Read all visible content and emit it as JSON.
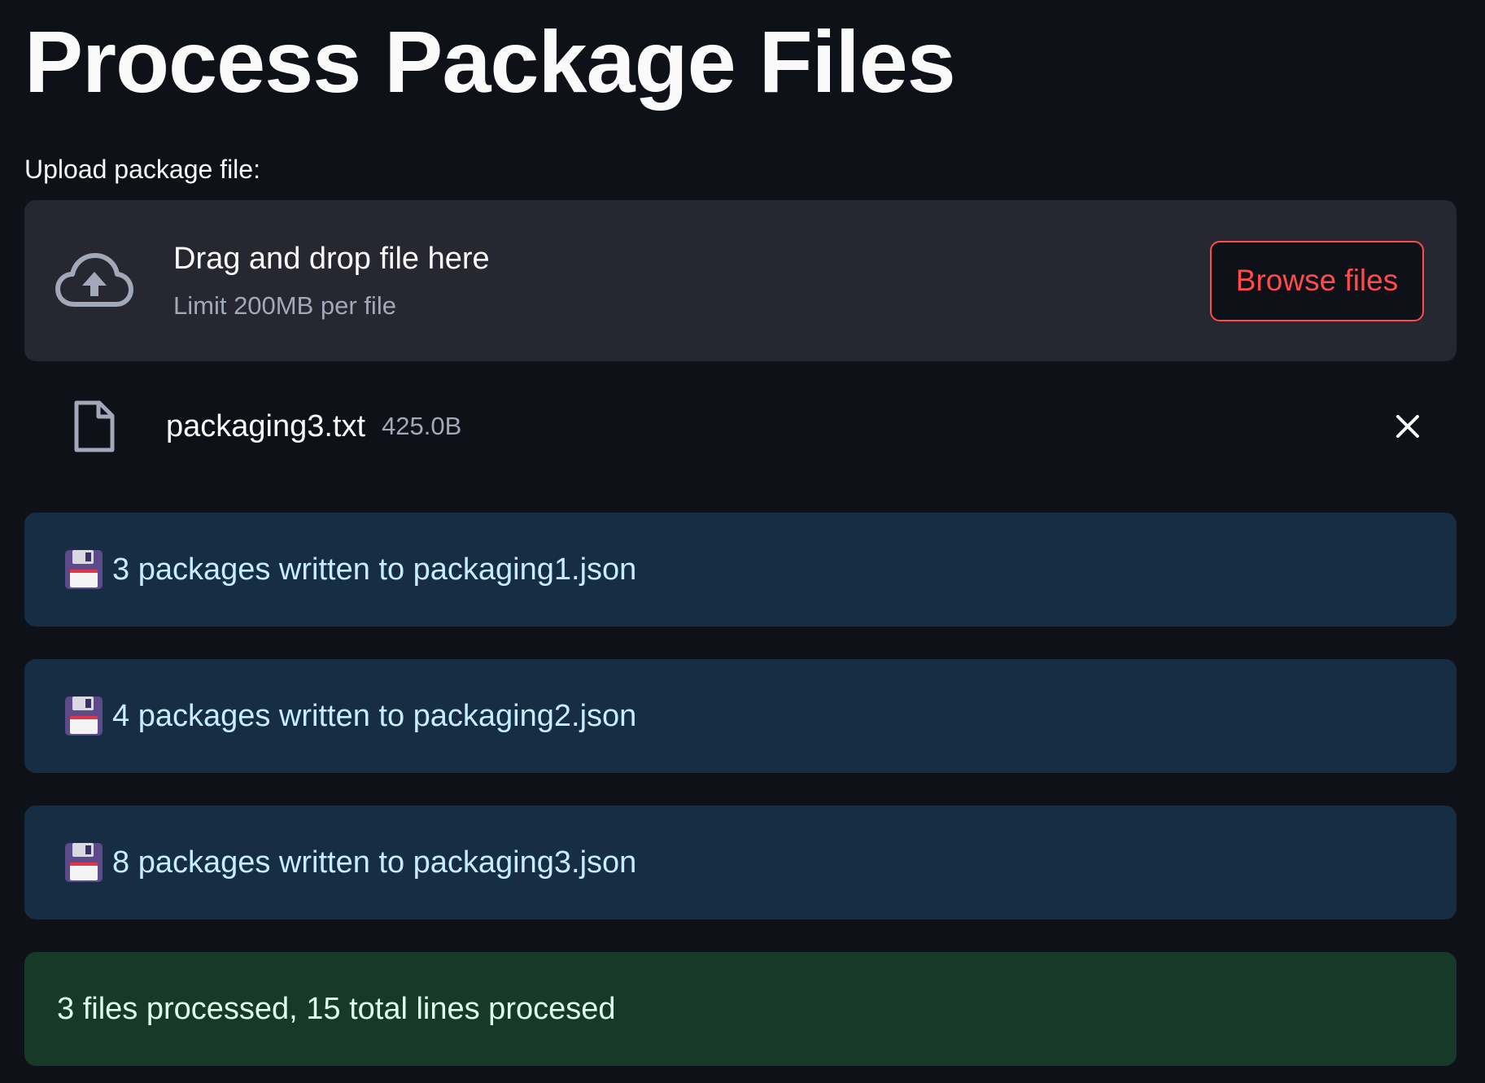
{
  "page": {
    "title": "Process Package Files"
  },
  "uploader": {
    "label": "Upload package file:",
    "drop_title": "Drag and drop file here",
    "limit_text": "Limit 200MB per file",
    "browse_label": "Browse files",
    "icon": "cloud-upload-icon"
  },
  "uploaded_file": {
    "name": "packaging3.txt",
    "size": "425.0B",
    "icon": "file-icon",
    "remove_icon": "close-icon"
  },
  "messages": [
    {
      "icon": "floppy-disk-icon",
      "text": "3 packages written to packaging1.json"
    },
    {
      "icon": "floppy-disk-icon",
      "text": "4 packages written to packaging2.json"
    },
    {
      "icon": "floppy-disk-icon",
      "text": "8 packages written to packaging3.json"
    }
  ],
  "summary": {
    "text": "3 files processed, 15 total lines procesed"
  },
  "colors": {
    "background": "#0e1117",
    "dropzone": "#262730",
    "accent": "#ff4b4b",
    "info_bg": "#172d43",
    "info_text": "#c7ebff",
    "success_bg": "#173928",
    "success_text": "#dffde9"
  }
}
